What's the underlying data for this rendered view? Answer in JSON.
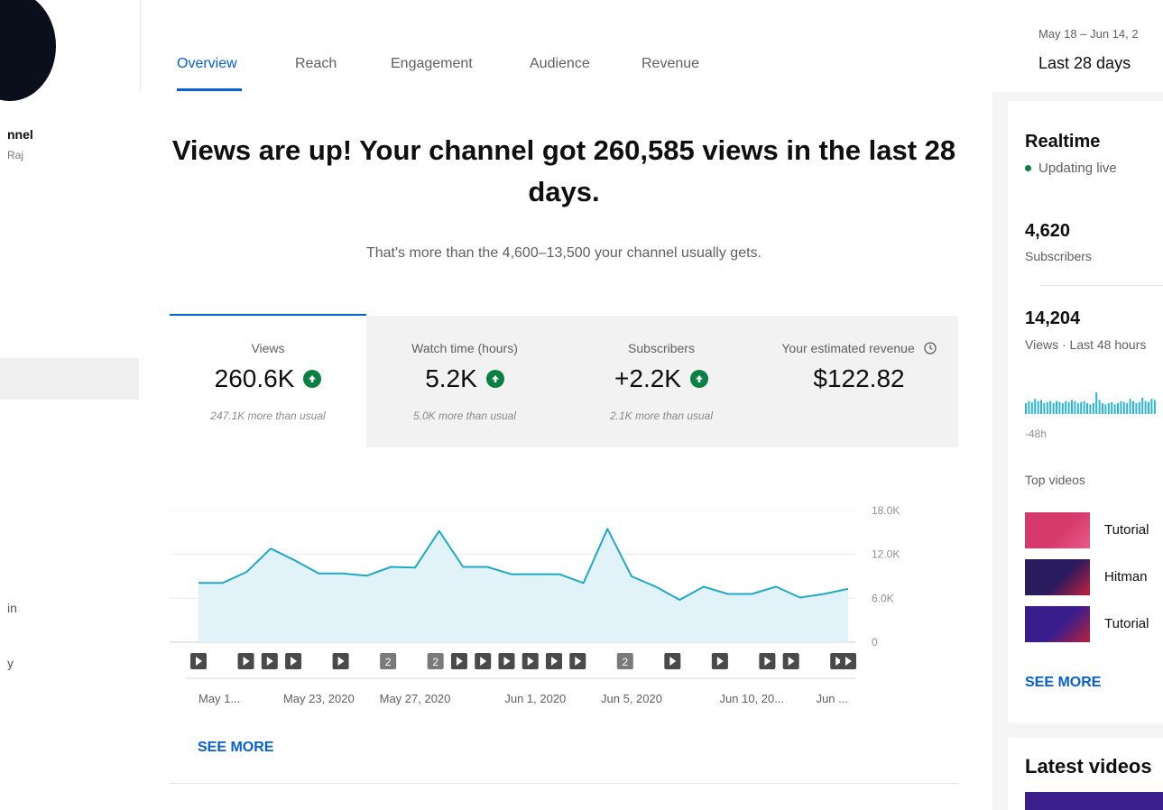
{
  "sidebar": {
    "channel_name_fragment": "nnel",
    "owner_fragment": "Raj",
    "item_a_fragment": "in",
    "item_b_fragment": "y"
  },
  "tabs": [
    {
      "label": "Overview",
      "active": true
    },
    {
      "label": "Reach",
      "active": false
    },
    {
      "label": "Engagement",
      "active": false
    },
    {
      "label": "Audience",
      "active": false
    },
    {
      "label": "Revenue",
      "active": false
    }
  ],
  "date": {
    "range": "May 18 – Jun 14, 2",
    "preset": "Last 28 days"
  },
  "headline": {
    "title": "Views are up! Your channel got 260,585 views in the last 28 days.",
    "subtitle": "That's more than the 4,600–13,500 your channel usually gets."
  },
  "metrics": [
    {
      "label": "Views",
      "value": "260.6K",
      "note": "247.1K more than usual",
      "trend": "up"
    },
    {
      "label": "Watch time (hours)",
      "value": "5.2K",
      "note": "5.0K more than usual",
      "trend": "up"
    },
    {
      "label": "Subscribers",
      "value": "+2.2K",
      "note": "2.1K more than usual",
      "trend": "up"
    },
    {
      "label": "Your estimated revenue",
      "value": "$122.82",
      "note": "",
      "info_icon": "clock-icon"
    }
  ],
  "chart_data": {
    "type": "area",
    "title": "",
    "xlabel": "",
    "ylabel": "",
    "ylim": [
      0,
      18000
    ],
    "yticks": [
      "18.0K",
      "12.0K",
      "6.0K",
      "0"
    ],
    "grid": true,
    "x": [
      "May 18, 2020",
      "May 19, 2020",
      "May 20, 2020",
      "May 21, 2020",
      "May 22, 2020",
      "May 23, 2020",
      "May 24, 2020",
      "May 25, 2020",
      "May 26, 2020",
      "May 27, 2020",
      "May 28, 2020",
      "May 29, 2020",
      "May 30, 2020",
      "May 31, 2020",
      "Jun 1, 2020",
      "Jun 2, 2020",
      "Jun 3, 2020",
      "Jun 4, 2020",
      "Jun 5, 2020",
      "Jun 6, 2020",
      "Jun 7, 2020",
      "Jun 8, 2020",
      "Jun 9, 2020",
      "Jun 10, 2020",
      "Jun 11, 2020",
      "Jun 12, 2020",
      "Jun 13, 2020",
      "Jun 14, 2020"
    ],
    "x_tick_labels": [
      "May 1...",
      "May 23, 2020",
      "May 27, 2020",
      "Jun 1, 2020",
      "Jun 5, 2020",
      "Jun 10, 20...",
      "Jun ..."
    ],
    "series": [
      {
        "values": [
          8100,
          8100,
          9600,
          12800,
          11200,
          9400,
          9400,
          9100,
          10300,
          10200,
          15200,
          10300,
          10300,
          9300,
          9300,
          9300,
          8100,
          15500,
          9000,
          7600,
          5800,
          7600,
          6600,
          6600,
          7600,
          6100,
          6600,
          7300
        ]
      }
    ],
    "line_color": "#1fa9c6",
    "fill_color": "#e1f3f8",
    "markers": [
      {
        "date_index": 0,
        "kind": "video"
      },
      {
        "date_index": 2,
        "kind": "video"
      },
      {
        "date_index": 3,
        "kind": "video"
      },
      {
        "date_index": 4,
        "kind": "video"
      },
      {
        "date_index": 6,
        "kind": "video"
      },
      {
        "date_index": 8,
        "kind": "count",
        "count": "2"
      },
      {
        "date_index": 10,
        "kind": "count",
        "count": "2"
      },
      {
        "date_index": 11,
        "kind": "video"
      },
      {
        "date_index": 12,
        "kind": "video"
      },
      {
        "date_index": 13,
        "kind": "video"
      },
      {
        "date_index": 14,
        "kind": "video"
      },
      {
        "date_index": 15,
        "kind": "video"
      },
      {
        "date_index": 16,
        "kind": "video"
      },
      {
        "date_index": 18,
        "kind": "count",
        "count": "2"
      },
      {
        "date_index": 20,
        "kind": "video"
      },
      {
        "date_index": 22,
        "kind": "video"
      },
      {
        "date_index": 24,
        "kind": "video"
      },
      {
        "date_index": 25,
        "kind": "video"
      },
      {
        "date_index": 27,
        "kind": "video"
      },
      {
        "date_index": 28,
        "kind": "video"
      }
    ]
  },
  "main_see_more": "SEE MORE",
  "realtime": {
    "title": "Realtime",
    "status": "Updating live",
    "subscribers_value": "4,620",
    "subscribers_label": "Subscribers",
    "views_value": "14,204",
    "views_label": "Views · Last 48 hours",
    "axis_label": "-48h",
    "bars": [
      0.5,
      0.6,
      0.55,
      0.7,
      0.6,
      0.65,
      0.5,
      0.55,
      0.6,
      0.5,
      0.6,
      0.55,
      0.5,
      0.6,
      0.55,
      0.65,
      0.6,
      0.5,
      0.55,
      0.6,
      0.5,
      0.45,
      0.5,
      1.0,
      0.65,
      0.5,
      0.45,
      0.5,
      0.55,
      0.45,
      0.5,
      0.6,
      0.55,
      0.5,
      0.7,
      0.6,
      0.5,
      0.55,
      0.75,
      0.6,
      0.55,
      0.7,
      0.65
    ],
    "bar_color": "#2bb6d6",
    "top_videos_title": "Top videos",
    "top_videos": [
      {
        "title": "Tutorial",
        "thumb_colors": [
          "#d6396b",
          "#e85a8a"
        ]
      },
      {
        "title": "Hitman",
        "thumb_colors": [
          "#2a1a5e",
          "#c2203a"
        ]
      },
      {
        "title": "Tutorial",
        "thumb_colors": [
          "#3a1d8c",
          "#b8223c"
        ]
      }
    ],
    "see_more": "SEE MORE",
    "latest_title": "Latest videos"
  },
  "colors": {
    "accent": "#065fd4",
    "positive": "#0b8043"
  }
}
